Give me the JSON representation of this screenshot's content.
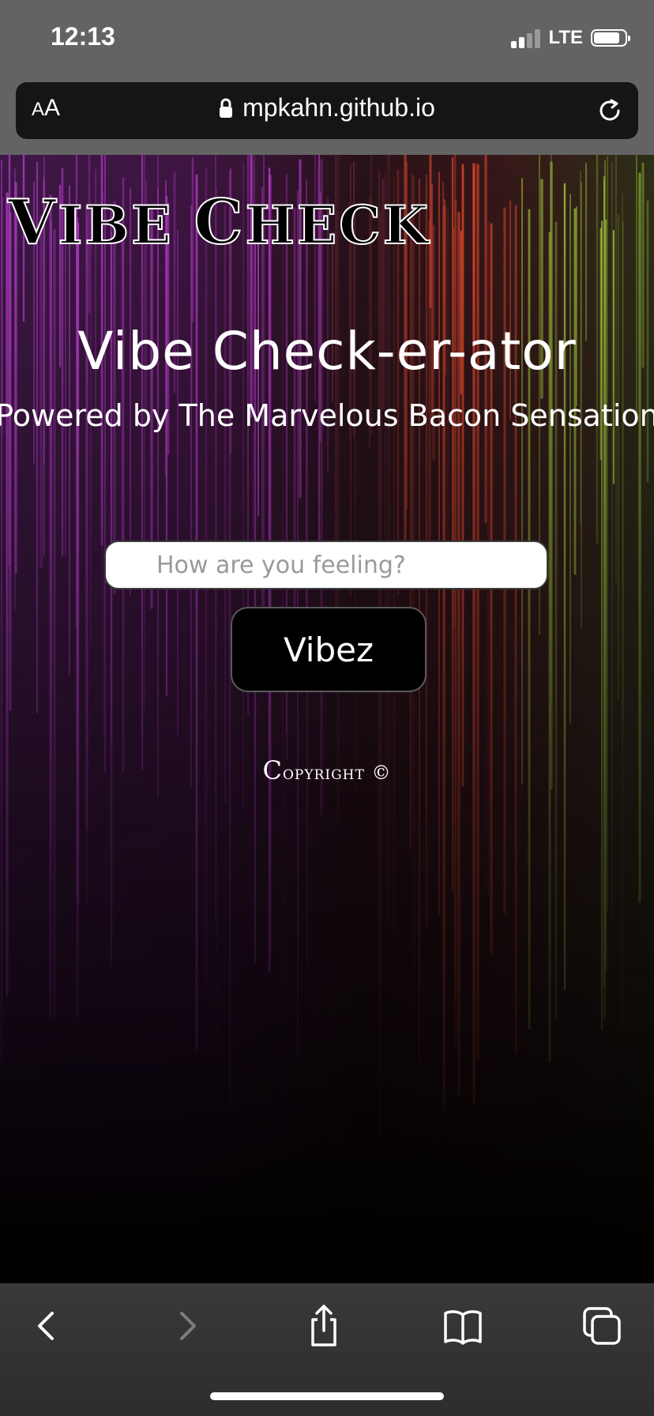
{
  "status_bar": {
    "time": "12:13",
    "network": "LTE"
  },
  "url_bar": {
    "aa_label_small": "A",
    "aa_label_large": "A",
    "url": "mpkahn.github.io",
    "icons": [
      "lock-icon",
      "reload-icon"
    ]
  },
  "page": {
    "logo": {
      "word1_cap": "V",
      "word1_rest": "IBE",
      "word2_cap": "C",
      "word2_rest": "HECK"
    },
    "heading": "Vibe Check-er-ator",
    "subheading": "Powered by The Marvelous Bacon Sensation",
    "input": {
      "placeholder": "How are you feeling?",
      "value": ""
    },
    "submit_label": "Vibez",
    "copyright_cap": "C",
    "copyright_rest": "opyright ©"
  },
  "toolbar": {
    "icons": [
      "back-icon",
      "forward-icon",
      "share-icon",
      "bookmarks-icon",
      "tabs-icon"
    ]
  },
  "colors": {
    "chrome_gray": "#636363",
    "url_bar_bg": "#151515",
    "page_bg": "#000000",
    "streak_purple": "#c13fd6",
    "streak_red": "#e04a2a",
    "streak_green": "#a6cf3a"
  }
}
